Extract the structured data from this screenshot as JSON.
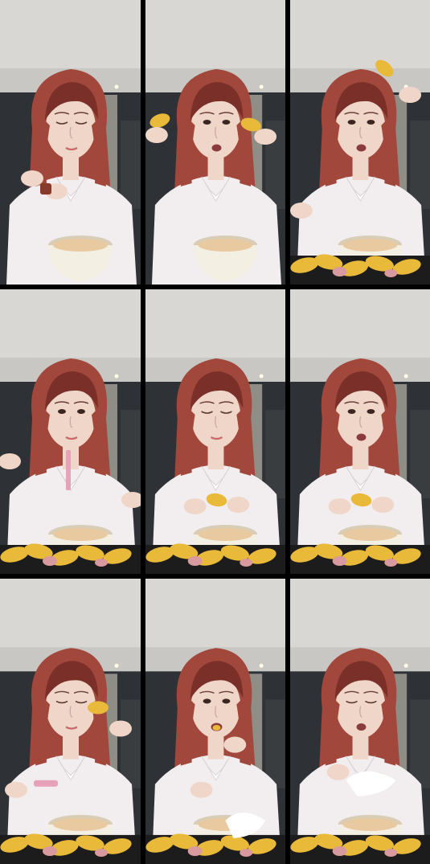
{
  "layout": {
    "columns": 3,
    "rows": 3,
    "gutter_color": "#000000"
  },
  "frames": [
    {
      "index": 1,
      "action": "pouring-sauce",
      "mouth": "closed",
      "eyes": "closed",
      "hold": "small-cup",
      "food_visible": false
    },
    {
      "index": 2,
      "action": "holding-food-up",
      "mouth": "open",
      "eyes": "open",
      "hold": "two-pieces",
      "food_visible": false
    },
    {
      "index": 3,
      "action": "showing-piece",
      "mouth": "open",
      "eyes": "open",
      "hold": "piece-top-right",
      "food_visible": true
    },
    {
      "index": 4,
      "action": "holding-chopsticks",
      "mouth": "closed",
      "eyes": "open",
      "hold": "pink-tool",
      "food_visible": true
    },
    {
      "index": 5,
      "action": "tearing-food",
      "mouth": "closed",
      "eyes": "closed",
      "hold": "tearing",
      "food_visible": true
    },
    {
      "index": 6,
      "action": "tearing-food",
      "mouth": "open",
      "eyes": "open",
      "hold": "tearing",
      "food_visible": true
    },
    {
      "index": 7,
      "action": "showing-piece",
      "mouth": "closed",
      "eyes": "closed",
      "hold": "piece-center",
      "food_visible": true
    },
    {
      "index": 8,
      "action": "eating",
      "mouth": "biting",
      "eyes": "open",
      "hold": "piece-mouth",
      "food_visible": true
    },
    {
      "index": 9,
      "action": "wiping-hands",
      "mouth": "open",
      "eyes": "closed",
      "hold": "tissue",
      "food_visible": true
    }
  ],
  "colors": {
    "ceiling": "#d9d7d4",
    "wall_dark": "#2e3236",
    "curtain": "#8e8d86",
    "hair": "#a2473b",
    "hair_dark": "#7a2f29",
    "skin": "#efd6c8",
    "shirt": "#f2eef0",
    "bowl": "#f4efe3",
    "bowl_rim": "#d9cdb6",
    "food_yellow": "#e9b93a",
    "food_pink": "#d89a9f",
    "tray": "#1c1c1c"
  }
}
